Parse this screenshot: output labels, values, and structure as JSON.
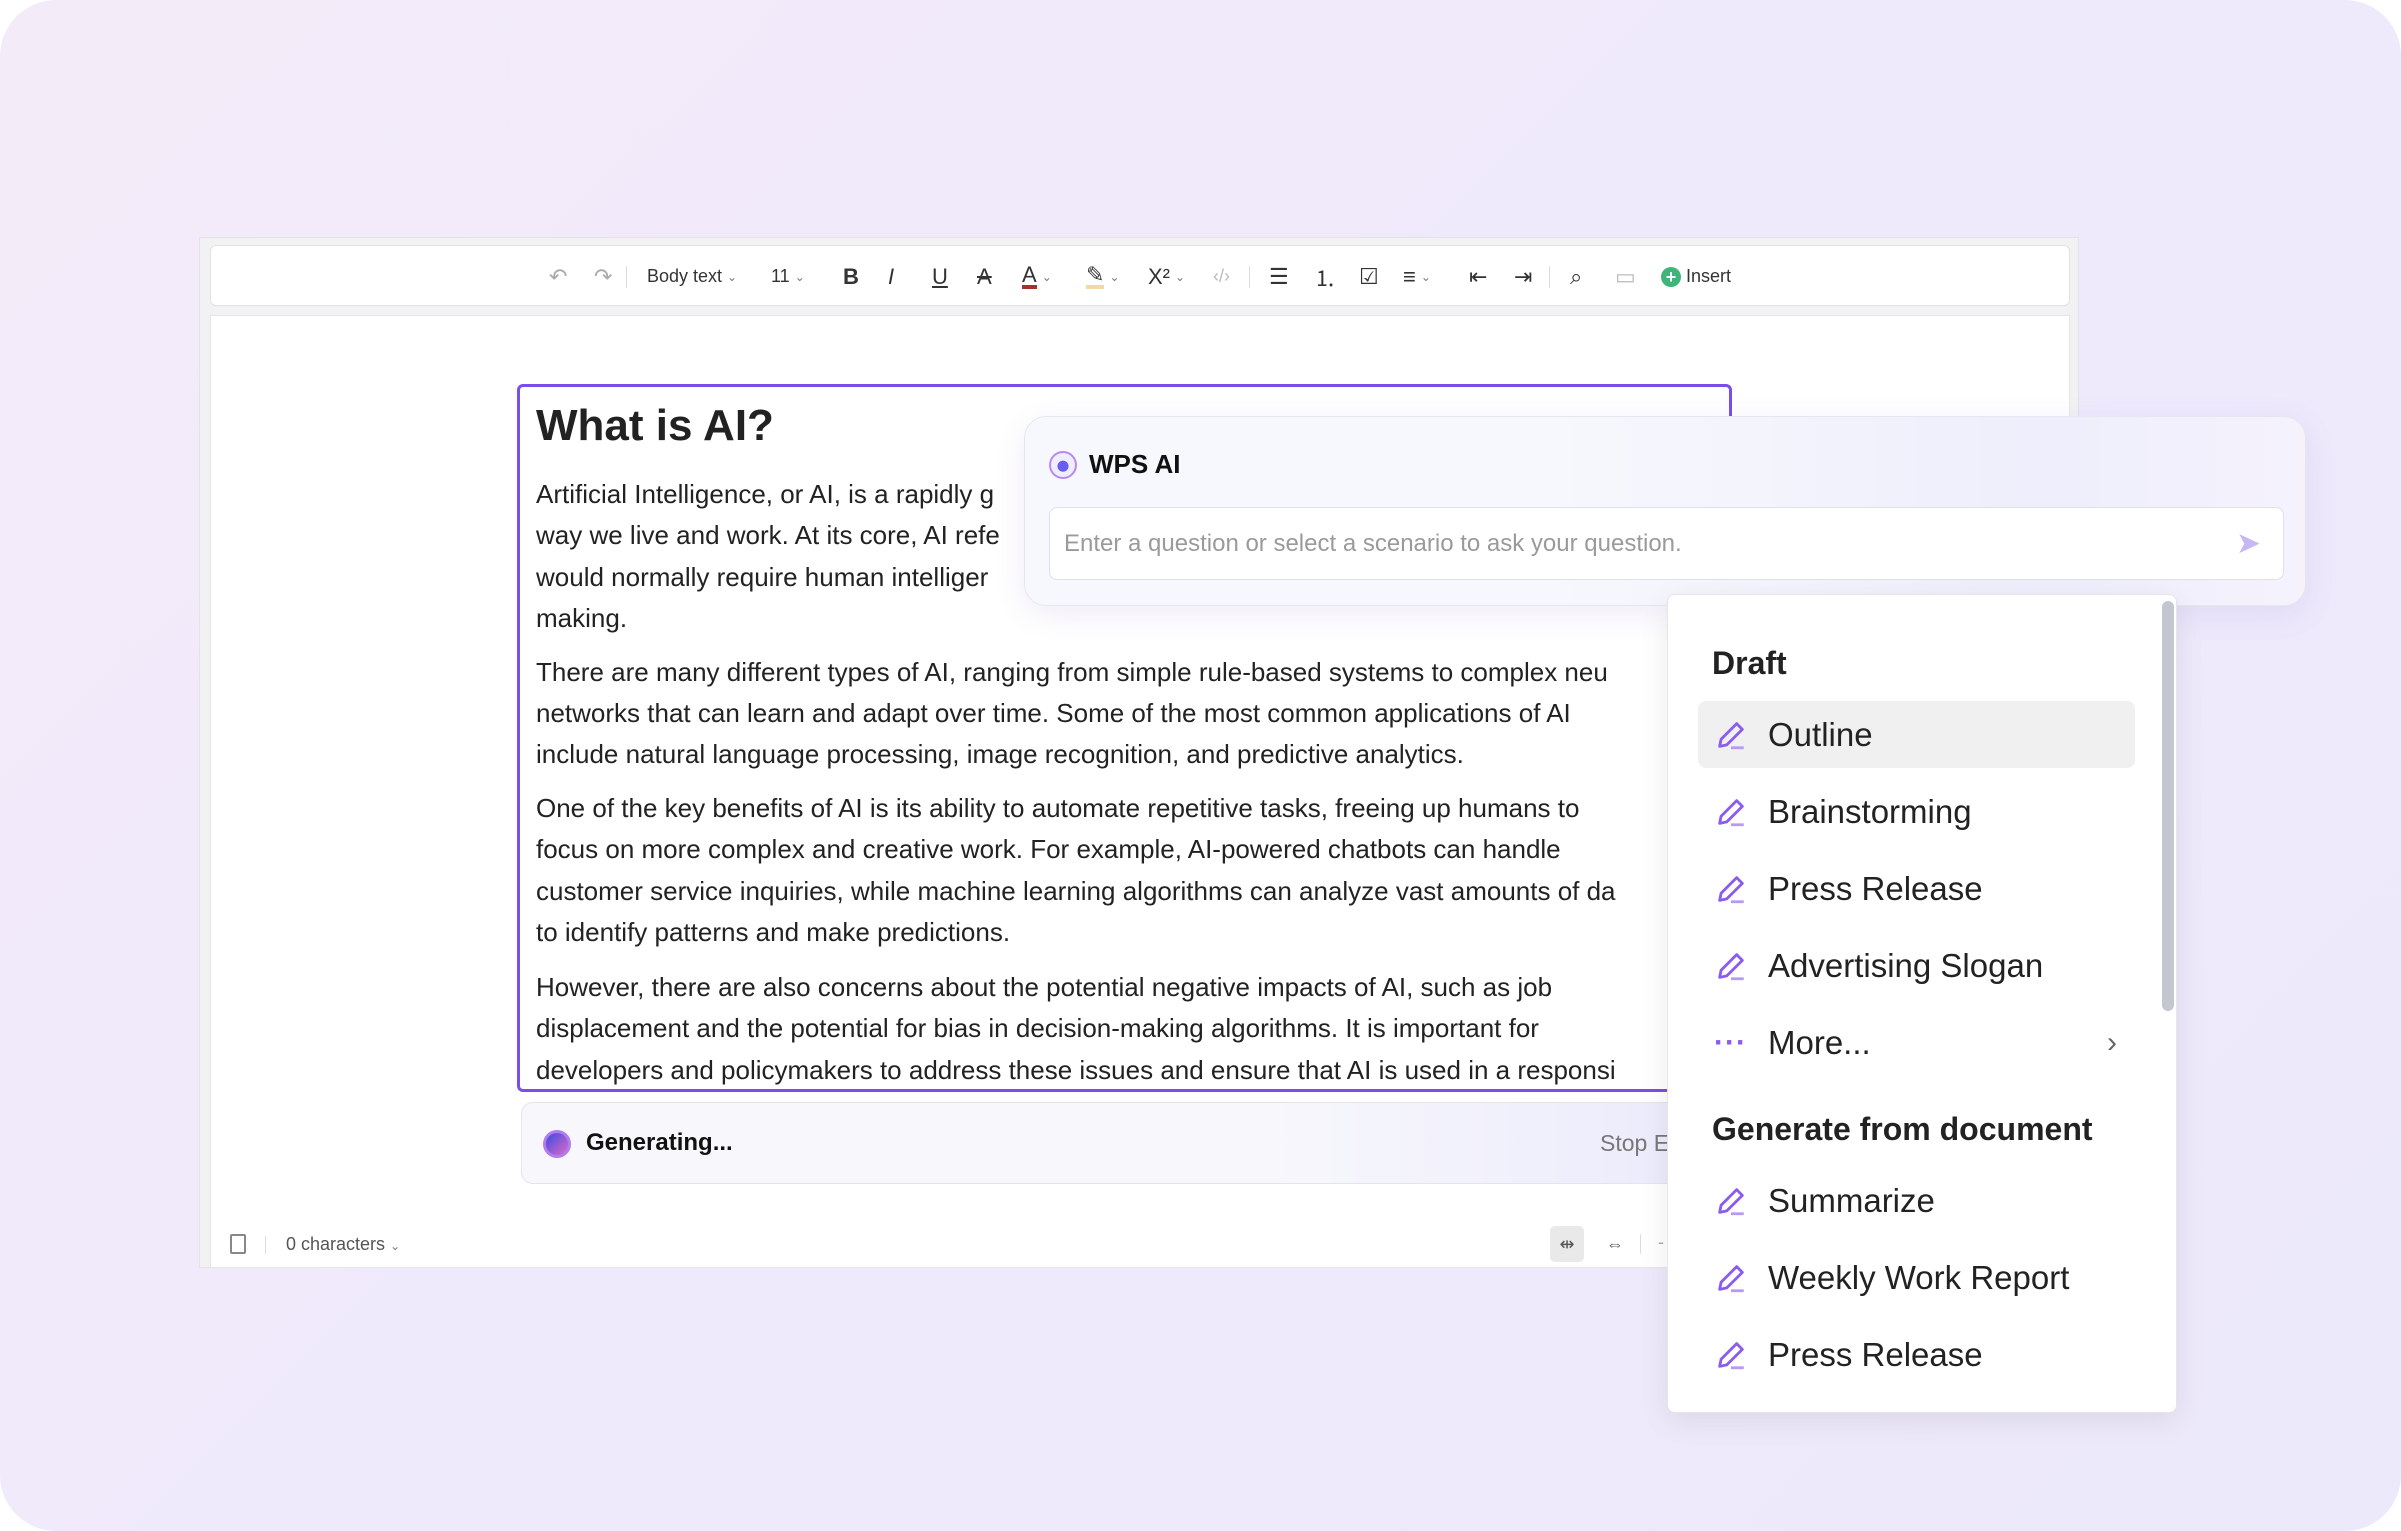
{
  "toolbar": {
    "style_select": "Body text",
    "size_select": "11",
    "insert_label": "Insert"
  },
  "document": {
    "title": "What is AI?",
    "lines": [
      "Artificial Intelligence, or AI, is a rapidly g",
      "way we live and work. At its core, AI refe",
      "would normally require human intelliger",
      "making.",
      "There are many different types of AI, ranging from simple rule-based systems to complex neu",
      "networks that can learn and adapt over time. Some of the most common applications of AI",
      "include natural language processing, image recognition, and predictive analytics.",
      "One of the key benefits of AI is its ability to automate repetitive tasks, freeing up humans to",
      "focus on more complex and creative work. For example, AI-powered chatbots can handle",
      "customer service inquiries, while machine learning algorithms can analyze vast amounts of da",
      "to identify patterns and make predictions.",
      "However, there are also concerns about the potential negative impacts of AI, such as job",
      "displacement and the potential for bias in decision-making algorithms. It is important for",
      "developers and policymakers to address these issues and ensure that AI is used in a responsi"
    ]
  },
  "generating": {
    "status": "Generating...",
    "stop_label": "Stop E"
  },
  "statusbar": {
    "char_count": "0 characters",
    "dash": "-"
  },
  "ai_panel": {
    "title": "WPS AI",
    "input_value": "",
    "input_placeholder": "Enter a question or select a scenario to ask your question."
  },
  "menu": {
    "draft_header": "Draft",
    "draft_items": [
      "Outline",
      "Brainstorming",
      "Press Release",
      "Advertising Slogan"
    ],
    "more_label": "More...",
    "doc_header": "Generate from document",
    "doc_items": [
      "Summarize",
      "Weekly Work Report",
      "Press Release"
    ],
    "selected": "Outline"
  },
  "colors": {
    "accent": "#7a4ee8",
    "insert_icon": "#3fb57a"
  }
}
